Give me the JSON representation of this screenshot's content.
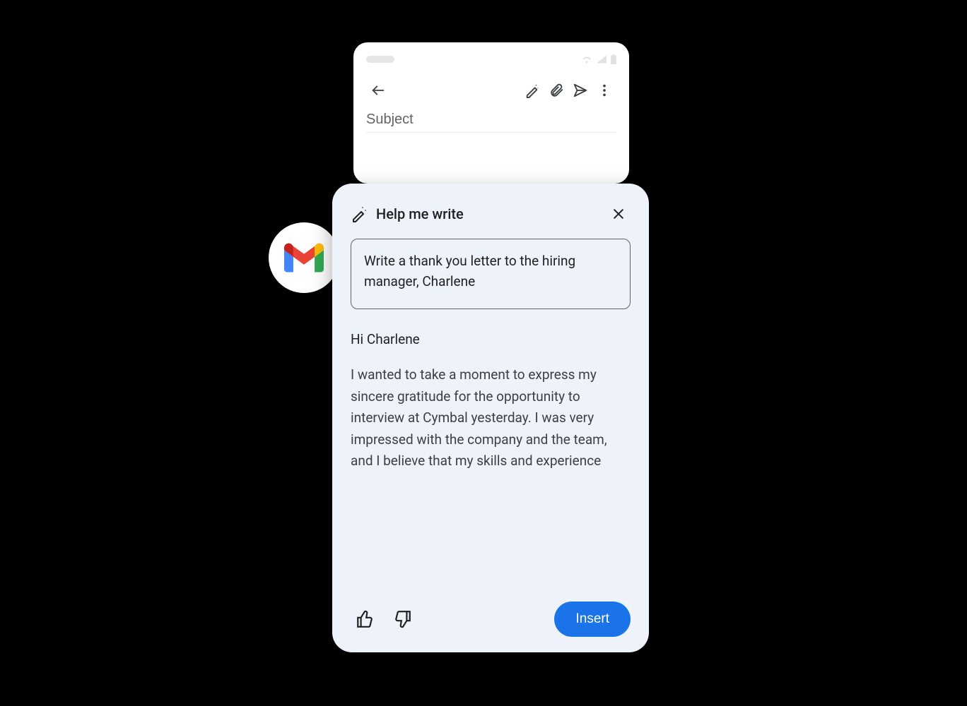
{
  "phone": {
    "subject_placeholder": "Subject"
  },
  "badge": {
    "icon_name": "gmail-icon"
  },
  "panel": {
    "title": "Help me write",
    "prompt_value": "Write a thank you letter to the hiring manager, Charlene",
    "generated": {
      "greeting": "Hi Charlene",
      "body": "I wanted to take a moment to express my sincere gratitude for the opportunity to interview at Cymbal yesterday. I was very impressed with the company and the team, and I believe that my skills and experience"
    },
    "insert_label": "Insert"
  }
}
